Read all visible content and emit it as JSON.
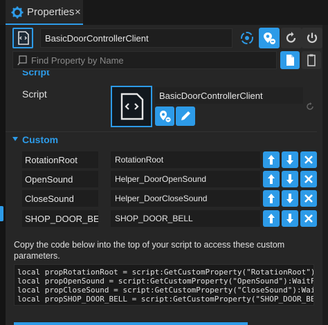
{
  "window": {
    "tab_title": "Properties",
    "tab_close": "×"
  },
  "header": {
    "object_name": "BasicDoorControllerClient"
  },
  "search": {
    "placeholder": "Find Property by Name"
  },
  "sections": {
    "script_section_label": "Script",
    "custom_section_label": "Custom"
  },
  "script": {
    "label": "Script",
    "value": "BasicDoorControllerClient"
  },
  "custom_properties": [
    {
      "name": "RotationRoot",
      "value": "RotationRoot"
    },
    {
      "name": "OpenSound",
      "value": "Helper_DoorOpenSound"
    },
    {
      "name": "CloseSound",
      "value": "Helper_DoorCloseSound"
    },
    {
      "name": "SHOP_DOOR_BEL",
      "value": "SHOP_DOOR_BELL"
    }
  ],
  "hint_text": "Copy the code below into the top of your script to access these custom parameters.",
  "code_lines": [
    "local propRotationRoot = script:GetCustomProperty(\"RotationRoot\")",
    "local propOpenSound = script:GetCustomProperty(\"OpenSound\"):WaitF",
    "local propCloseSound = script:GetCustomProperty(\"CloseSound\"):Wai",
    "local propSHOP_DOOR_BELL = script:GetCustomProperty(\"SHOP_DOOR_BE"
  ],
  "colors": {
    "accent": "#2d9be8",
    "panel_bg": "#262626",
    "field_bg": "#1e1e1e"
  },
  "icons": {
    "tab": "gear-icon",
    "header_object": "script-file-icon",
    "network": "network-icon",
    "pin": "location-pin-icon",
    "revert": "revert-icon",
    "power": "power-icon",
    "search": "search-icon",
    "copy_page": "page-icon",
    "clipboard": "clipboard-icon",
    "up": "arrow-up-icon",
    "down": "arrow-down-icon",
    "delete": "close-icon",
    "edit": "pencil-icon"
  }
}
